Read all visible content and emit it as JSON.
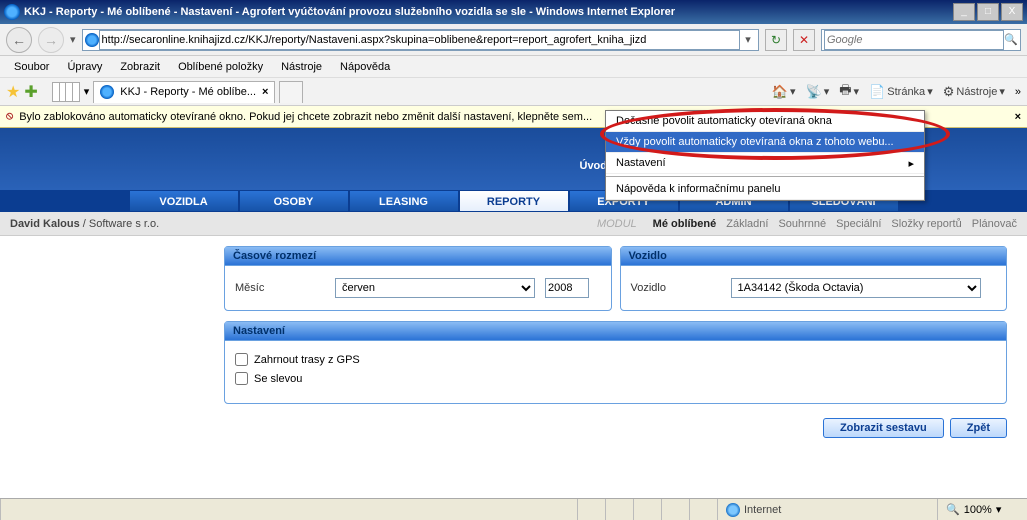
{
  "titlebar": {
    "text": "KKJ - Reporty - Mé oblíbené - Nastavení - Agrofert vyúčtování provozu služebního vozidla se sle - Windows Internet Explorer",
    "min": "_",
    "max": "□",
    "close": "X"
  },
  "address_url": "http://secaronline.knihajizd.cz/KKJ/reporty/Nastaveni.aspx?skupina=oblibene&report=report_agrofert_kniha_jizd",
  "search_placeholder": "Google",
  "menu": {
    "soubor": "Soubor",
    "upravy": "Úpravy",
    "zobrazit": "Zobrazit",
    "oblibene": "Oblíbené položky",
    "nastroje": "Nástroje",
    "napoveda": "Nápověda"
  },
  "tab_label": "KKJ - Reporty - Mé oblíbe...",
  "cmdbar": {
    "stranka": "Stránka",
    "nastroje": "Nástroje"
  },
  "infobar": "Bylo zablokováno automaticky otevírané okno. Pokud jej chcete zobrazit nebo změnit další nastavení, klepněte sem...",
  "popup": {
    "temp": "Dočasně povolit automaticky otevíraná okna",
    "always": "Vždy povolit automaticky otevíraná okna z tohoto webu...",
    "settings": "Nastavení",
    "help": "Nápověda k informačnímu panelu"
  },
  "uvod": "Úvod",
  "topnav": {
    "vozidla": "VOZIDLA",
    "osoby": "OSOBY",
    "leasing": "LEASING",
    "reporty": "REPORTY",
    "exporty": "EXPORTY",
    "admin": "ADMIN",
    "sledovani": "SLEDOVÁNÍ"
  },
  "user": {
    "name": "David Kalous",
    "sep": " / ",
    "company": "Software s r.o."
  },
  "modul": "MODUL",
  "subtabs": {
    "oblibene": "Mé oblíbené",
    "zakladni": "Základní",
    "souhrnne": "Souhrnné",
    "specialni": "Speciální",
    "slozky": "Složky reportů",
    "planovac": "Plánovač"
  },
  "panel1": {
    "title": "Časové rozmezí",
    "label": "Měsíc",
    "month": "červen",
    "year": "2008"
  },
  "panel2": {
    "title": "Vozidlo",
    "label": "Vozidlo",
    "value": "1A34142 (Škoda Octavia)"
  },
  "panel3": {
    "title": "Nastavení",
    "check1": "Zahrnout trasy z GPS",
    "check2": "Se slevou"
  },
  "buttons": {
    "zobrazit": "Zobrazit sestavu",
    "zpet": "Zpět"
  },
  "status": {
    "zone": "Internet",
    "zoom": "100%"
  }
}
